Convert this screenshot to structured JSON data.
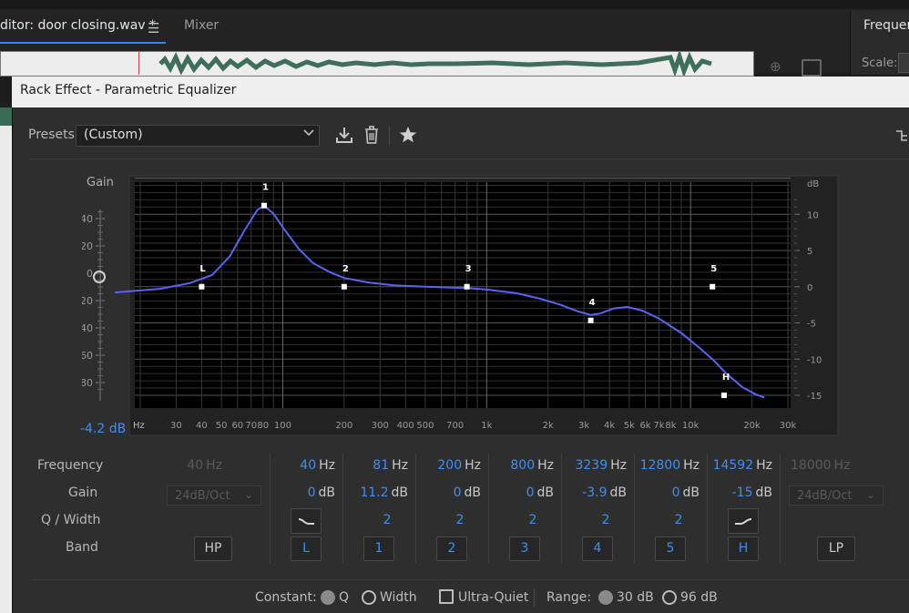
{
  "background": {
    "editor_tab": "Editor: door closing.wav *",
    "editor_tab_visible": "ditor: door closing.wav *",
    "mixer_tab": "Mixer",
    "right_panel_title": "Frequen",
    "scale_label": "Scale:"
  },
  "dialog": {
    "title": "Rack Effect - Parametric Equalizer",
    "presets_label": "Presets:",
    "presets_value": "(Custom)"
  },
  "graph": {
    "gain_label": "Gain",
    "gain_value": "-4.2 dB",
    "left_scale": [
      "40",
      "20",
      "0",
      "-20",
      "-40",
      "-60",
      "-80"
    ],
    "right_unit": "dB",
    "right_scale": [
      "10",
      "5",
      "0",
      "-5",
      "-10",
      "-15"
    ],
    "freq_unit_label": "Hz",
    "freq_ticks": [
      {
        "f": 30,
        "label": "30"
      },
      {
        "f": 40,
        "label": "40"
      },
      {
        "f": 50,
        "label": "50"
      },
      {
        "f": 60,
        "label": "60"
      },
      {
        "f": 70,
        "label": "70"
      },
      {
        "f": 80,
        "label": "80"
      },
      {
        "f": 100,
        "label": "100"
      },
      {
        "f": 200,
        "label": "200"
      },
      {
        "f": 300,
        "label": "300"
      },
      {
        "f": 400,
        "label": "400"
      },
      {
        "f": 500,
        "label": "500"
      },
      {
        "f": 700,
        "label": "700"
      },
      {
        "f": 1000,
        "label": "1k"
      },
      {
        "f": 2000,
        "label": "2k"
      },
      {
        "f": 3000,
        "label": "3k"
      },
      {
        "f": 4000,
        "label": "4k"
      },
      {
        "f": 5000,
        "label": "5k"
      },
      {
        "f": 6000,
        "label": "6k"
      },
      {
        "f": 7000,
        "label": "7k"
      },
      {
        "f": 8000,
        "label": "8k"
      },
      {
        "f": 10000,
        "label": "10k"
      },
      {
        "f": 20000,
        "label": "20k"
      },
      {
        "f": 30000,
        "label": "30k"
      }
    ],
    "nodes": [
      {
        "label": "L",
        "freq": 40,
        "gain": 0
      },
      {
        "label": "1",
        "freq": 81,
        "gain": 11.2
      },
      {
        "label": "2",
        "freq": 200,
        "gain": 0
      },
      {
        "label": "3",
        "freq": 800,
        "gain": 0
      },
      {
        "label": "4",
        "freq": 3239,
        "gain": -3.9
      },
      {
        "label": "5",
        "freq": 12800,
        "gain": 0
      },
      {
        "label": "H",
        "freq": 14592,
        "gain": -15
      }
    ],
    "curve": [
      [
        15,
        -0.8
      ],
      [
        25,
        -0.3
      ],
      [
        35,
        0.5
      ],
      [
        45,
        1.6
      ],
      [
        55,
        4.2
      ],
      [
        65,
        7.8
      ],
      [
        75,
        10.6
      ],
      [
        81,
        11.2
      ],
      [
        90,
        10.1
      ],
      [
        100,
        8.2
      ],
      [
        120,
        5.2
      ],
      [
        140,
        3.3
      ],
      [
        170,
        2.0
      ],
      [
        200,
        1.2
      ],
      [
        260,
        0.6
      ],
      [
        350,
        0.2
      ],
      [
        500,
        0.0
      ],
      [
        800,
        -0.2
      ],
      [
        1000,
        -0.4
      ],
      [
        1400,
        -0.9
      ],
      [
        1800,
        -1.6
      ],
      [
        2300,
        -2.5
      ],
      [
        2800,
        -3.4
      ],
      [
        3239,
        -3.9
      ],
      [
        3600,
        -3.7
      ],
      [
        4200,
        -3.0
      ],
      [
        4900,
        -2.8
      ],
      [
        5800,
        -3.3
      ],
      [
        7000,
        -4.4
      ],
      [
        9000,
        -6.4
      ],
      [
        11000,
        -8.4
      ],
      [
        13000,
        -10.2
      ],
      [
        15000,
        -12.0
      ],
      [
        18000,
        -13.9
      ],
      [
        21000,
        -14.9
      ],
      [
        23000,
        -15.3
      ]
    ],
    "curve_color": "#5b63f0"
  },
  "rows": {
    "frequency": "Frequency",
    "gain": "Gain",
    "q_width": "Q / Width",
    "band": "Band"
  },
  "bands": {
    "hp": {
      "freq": "40",
      "unit": "Hz",
      "slope": "24dB/Oct",
      "button": "HP"
    },
    "l": {
      "freq": "40",
      "freq_unit": "Hz",
      "gain": "0",
      "gain_unit": "dB",
      "button": "L"
    },
    "b1": {
      "freq": "81",
      "freq_unit": "Hz",
      "gain": "11.2",
      "gain_unit": "dB",
      "q": "2",
      "button": "1"
    },
    "b2": {
      "freq": "200",
      "freq_unit": "Hz",
      "gain": "0",
      "gain_unit": "dB",
      "q": "2",
      "button": "2"
    },
    "b3": {
      "freq": "800",
      "freq_unit": "Hz",
      "gain": "0",
      "gain_unit": "dB",
      "q": "2",
      "button": "3"
    },
    "b4": {
      "freq": "3239",
      "freq_unit": "Hz",
      "gain": "-3.9",
      "gain_unit": "dB",
      "q": "2",
      "button": "4"
    },
    "b5": {
      "freq": "12800",
      "freq_unit": "Hz",
      "gain": "0",
      "gain_unit": "dB",
      "q": "2",
      "button": "5"
    },
    "h": {
      "freq": "14592",
      "freq_unit": "Hz",
      "gain": "-15",
      "gain_unit": "dB",
      "button": "H"
    },
    "lp": {
      "freq": "18000",
      "unit": "Hz",
      "slope": "24dB/Oct",
      "button": "LP"
    }
  },
  "footer": {
    "constant_label": "Constant:",
    "q_option": "Q",
    "width_option": "Width",
    "ultra_quiet": "Ultra-Quiet",
    "range_label": "Range:",
    "range_30": "30 dB",
    "range_96": "96 dB"
  },
  "colors": {
    "accent": "#3f8ef5",
    "curve": "#5b63f0",
    "disabled": "#5a5a5a"
  }
}
